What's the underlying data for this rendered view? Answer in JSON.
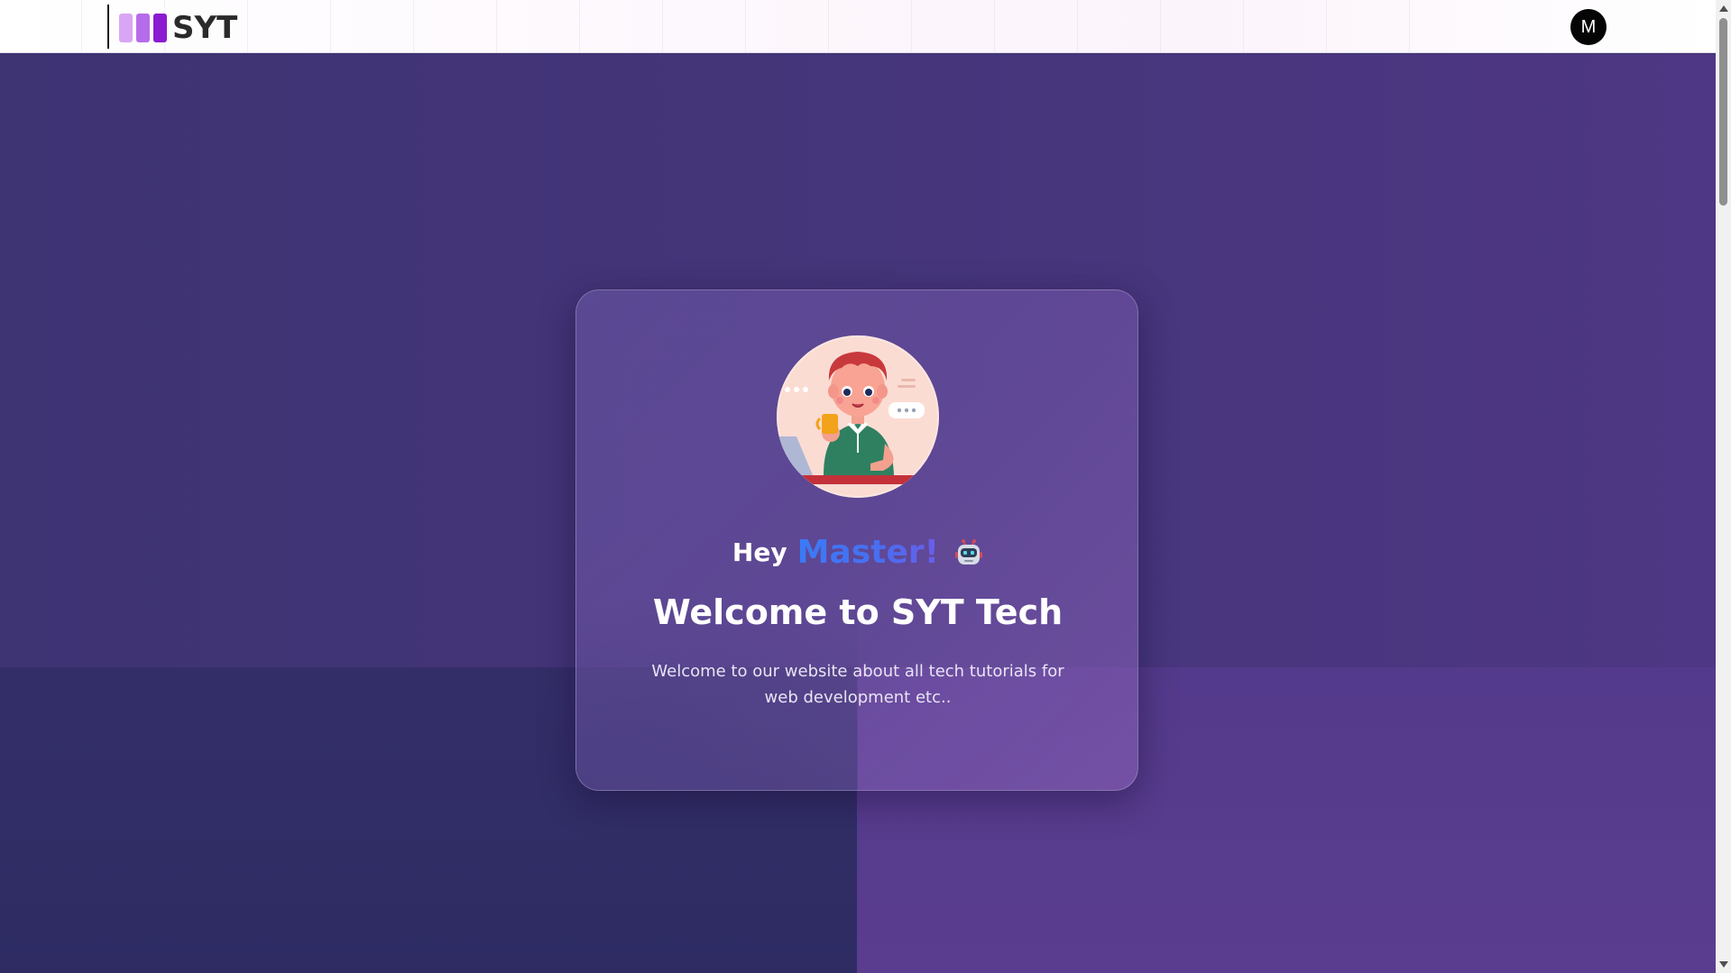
{
  "navbar": {
    "logo_text": "SYT",
    "avatar_initial": "M"
  },
  "hero": {
    "greeting_prefix": "Hey",
    "greeting_name": "Master!",
    "greeting_icon": "robot-icon",
    "title": "Welcome to SYT Tech",
    "description": "Welcome to our website about all tech tutorials for web development etc.."
  },
  "colors": {
    "brand_bar_light": "#d9a6f5",
    "brand_bar_mid": "#b56ce8",
    "brand_bar_dark": "#8a1bd1",
    "accent_name": "#3a7bf7",
    "background_left": "#3d3272",
    "background_right": "#51388a"
  }
}
